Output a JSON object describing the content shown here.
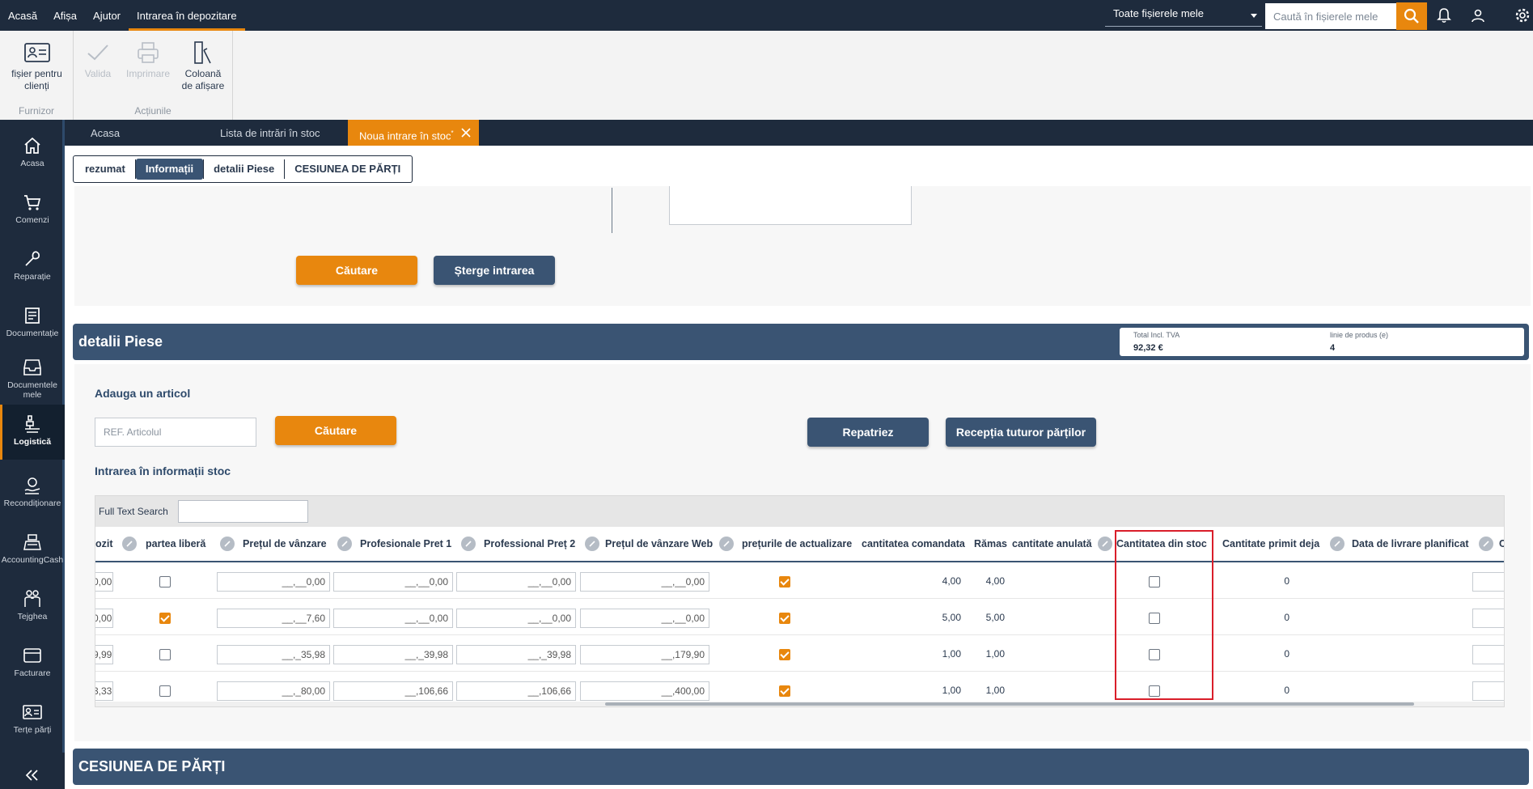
{
  "topmenu": {
    "items": [
      {
        "label": "Acasă"
      },
      {
        "label": "Afișa"
      },
      {
        "label": "Ajutor"
      },
      {
        "label": "Intrarea în depozitare",
        "active": true
      }
    ],
    "scope_value": "Toate fișierele mele",
    "search_placeholder": "Caută în fișierele mele"
  },
  "ribbon": {
    "groups": [
      {
        "title": "Furnizor",
        "buttons": [
          {
            "label": "fișier pentru clienți",
            "icon": "contact-card-icon"
          }
        ]
      },
      {
        "title": "Acțiunile",
        "buttons": [
          {
            "label": "Valida",
            "icon": "check-icon",
            "disabled": true
          },
          {
            "label": "Imprimare",
            "icon": "printer-icon",
            "disabled": true
          },
          {
            "label": "Coloană de afișare",
            "icon": "column-display-icon"
          }
        ]
      }
    ],
    "btn_client": "fișier pentru clienți",
    "btn_validate": "Valida",
    "btn_print": "Imprimare",
    "btn_columns": "Coloană de afișare",
    "group_supplier": "Furnizor",
    "group_actions": "Acțiunile"
  },
  "sidebar": {
    "items": [
      {
        "label": "Acasa",
        "icon": "home-icon"
      },
      {
        "label": "Comenzi",
        "icon": "cart-icon"
      },
      {
        "label": "Reparație",
        "icon": "wrench-icon"
      },
      {
        "label": "Documentație",
        "icon": "document-icon"
      },
      {
        "label": "Documentele mele",
        "icon": "inbox-icon"
      },
      {
        "label": "Logistică",
        "icon": "logistics-icon",
        "active": true
      },
      {
        "label": "Recondiționare",
        "icon": "recondition-icon"
      },
      {
        "label": "AccountingCash",
        "icon": "cash-register-icon"
      },
      {
        "label": "Tejghea",
        "icon": "people-icon"
      },
      {
        "label": "Facturare",
        "icon": "card-icon"
      },
      {
        "label": "Terțe părți",
        "icon": "id-card-icon"
      }
    ],
    "collapse_icon": "double-chevron-left-icon"
  },
  "doctabs": {
    "home": "Acasa",
    "list": "Lista de intrări în stoc",
    "new": "Noua intrare în stoc",
    "new_marker": "*"
  },
  "sectabs": {
    "summary": "rezumat",
    "info": "Informații",
    "parts": "detalii Piese",
    "cession": "CESIUNEA DE PĂRȚI"
  },
  "info_panel": {
    "search_button": "Căutare",
    "delete_button": "Șterge intrarea"
  },
  "parts": {
    "title": "detalii Piese",
    "total_label": "Total Incl. TVA",
    "total_value": "92,32 €",
    "lines_label": "linie de produs (e)",
    "lines_value": "4",
    "add_article": "Adauga un articol",
    "ref_placeholder": "REF. Articolul",
    "search_button": "Căutare",
    "repatriate_button": "Repatriez",
    "receive_all_button": "Recepția tuturor părților",
    "stock_info_title": "Intrarea în informații stoc",
    "fulltext_label": "Full Text Search"
  },
  "grid": {
    "headers": {
      "deposit": "ozit",
      "free_part": "partea liberă",
      "sale_price": "Prețul de vânzare",
      "pro_price1": "Profesionale Pret 1",
      "pro_price2": "Professional Preț 2",
      "web_price": "Prețul de vânzare Web",
      "update_prices": "prețurile de actualizare",
      "qty_ordered": "cantitatea comandata",
      "remaining": "Rămas",
      "qty_cancelled": "cantitate anulată",
      "qty_from_stock": "Cantitatea din stoc",
      "qty_received": "Cantitate primit deja",
      "planned_delivery": "Data de livrare planificat",
      "last": "C"
    },
    "rows": [
      {
        "deposit": "0,00",
        "free_part": false,
        "sale_price": "__,__0,00",
        "pro_price1": "__,__0,00",
        "pro_price2": "__,__0,00",
        "web_price": "__,__0,00",
        "update_prices": true,
        "qty_ordered": "4,00",
        "remaining": "4,00",
        "qty_from_stock": false,
        "qty_received": "0"
      },
      {
        "deposit": "0,00",
        "free_part": true,
        "sale_price": "__,__7,60",
        "pro_price1": "__,__0,00",
        "pro_price2": "__,__0,00",
        "web_price": "__,__0,00",
        "update_prices": true,
        "qty_ordered": "5,00",
        "remaining": "5,00",
        "qty_from_stock": false,
        "qty_received": "0"
      },
      {
        "deposit": "9,99",
        "free_part": false,
        "sale_price": "__,_35,98",
        "pro_price1": "__,_39,98",
        "pro_price2": "__,_39,98",
        "web_price": "__,179,90",
        "update_prices": true,
        "qty_ordered": "1,00",
        "remaining": "1,00",
        "qty_from_stock": false,
        "qty_received": "0"
      },
      {
        "deposit": "3,33",
        "free_part": false,
        "sale_price": "__,_80,00",
        "pro_price1": "__,106,66",
        "pro_price2": "__,106,66",
        "web_price": "__,400,00",
        "update_prices": true,
        "qty_ordered": "1,00",
        "remaining": "1,00",
        "qty_from_stock": false,
        "qty_received": "0"
      }
    ]
  },
  "cession": {
    "title": "CESIUNEA DE PĂRȚI"
  },
  "colors": {
    "accent": "#e8870e",
    "navy": "#1e2b3d",
    "band": "#3a5473",
    "highlight": "#d91e2a"
  }
}
